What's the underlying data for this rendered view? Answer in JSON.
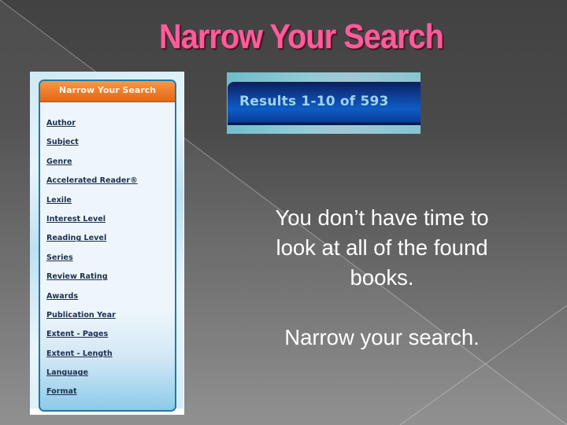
{
  "slide": {
    "title": "Narrow Your Search",
    "title_color": "#ff5c9a",
    "body_lines": [
      "You don’t have time to",
      "look at all of the found",
      "books."
    ],
    "call_to_action": "Narrow your search."
  },
  "narrow_panel": {
    "header": "Narrow Your Search",
    "header_color": "#ee8030",
    "filters": [
      "Author",
      "Subject",
      "Genre",
      "Accelerated Reader®",
      "Lexile",
      "Interest Level",
      "Reading Level",
      "Series",
      "Review Rating",
      "Awards",
      "Publication Year",
      "Extent - Pages",
      "Extent - Length",
      "Language",
      "Format"
    ]
  },
  "results_banner": {
    "text": "Results 1-10 of 593",
    "range_start": 1,
    "range_end": 10,
    "total": 593
  }
}
